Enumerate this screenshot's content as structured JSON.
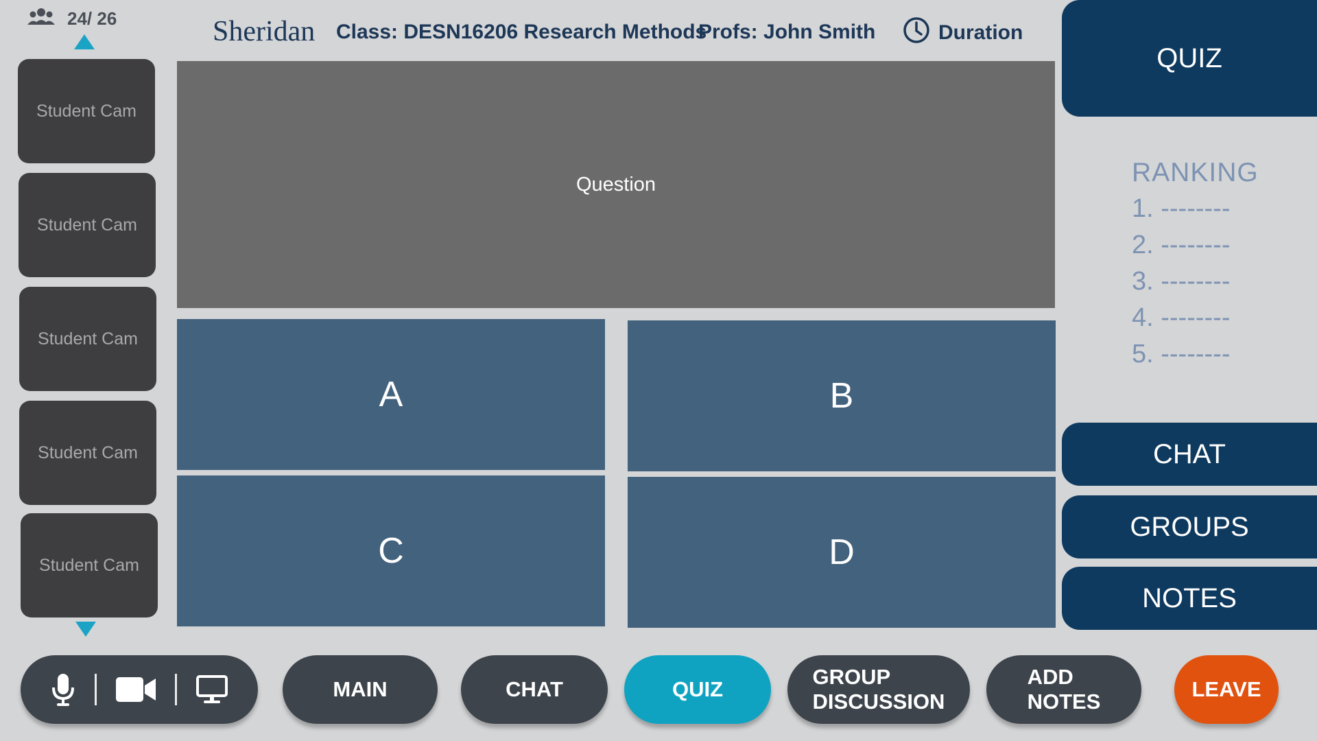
{
  "participants": {
    "count": "24/ 26"
  },
  "students": [
    {
      "label": "Student Cam"
    },
    {
      "label": "Student Cam"
    },
    {
      "label": "Student Cam"
    },
    {
      "label": "Student Cam"
    },
    {
      "label": "Student Cam"
    }
  ],
  "header": {
    "brand": "Sheridan",
    "class_info": "Class: DESN16206 Research Methods",
    "profs": "Profs:  John Smith",
    "duration": "Duration"
  },
  "quiz": {
    "question": "Question",
    "answers": [
      "A",
      "B",
      "C",
      "D"
    ]
  },
  "side": {
    "quiz_tab": "QUIZ",
    "ranking_title": "RANKING",
    "ranking_items": [
      "1. --------",
      "2. --------",
      "3. --------",
      "4. --------",
      "5. --------"
    ],
    "chat": "CHAT",
    "groups": "GROUPS",
    "notes": "NOTES"
  },
  "toolbar": {
    "main": "MAIN",
    "chat": "CHAT",
    "quiz": "QUIZ",
    "group_discussion": "GROUP\nDISCUSSION",
    "add_notes": "ADD\nNOTES",
    "leave": "LEAVE"
  },
  "colors": {
    "background": "#d4d5d7",
    "navy": "#0f3a5f",
    "answer_blue": "#43627d",
    "accent_teal": "#0fa3c1",
    "leave_orange": "#e1520f",
    "dark_pill": "#3e444c"
  },
  "icons": {
    "participants": "people-group-icon",
    "mic": "microphone-icon",
    "camera": "video-camera-icon",
    "screen": "monitor-icon",
    "clock": "clock-icon"
  }
}
